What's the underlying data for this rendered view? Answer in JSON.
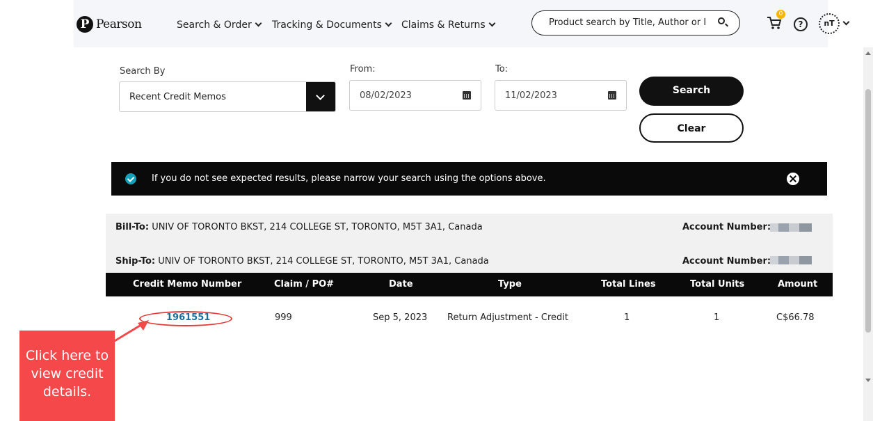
{
  "header": {
    "logo_text": "Pearson",
    "nav": [
      {
        "label": "Search & Order"
      },
      {
        "label": "Tracking & Documents"
      },
      {
        "label": "Claims & Returns"
      }
    ],
    "search_placeholder": "Product search by Title, Author or I",
    "cart_count": "0",
    "help_symbol": "?",
    "avatar_initials": "nT"
  },
  "form": {
    "search_by_label": "Search By",
    "search_by_value": "Recent Credit Memos",
    "from_label": "From:",
    "from_value": "08/02/2023",
    "to_label": "To:",
    "to_value": "11/02/2023",
    "search_button": "Search",
    "clear_button": "Clear"
  },
  "alert": {
    "message": "If you do not see expected results, please narrow your search using the options above."
  },
  "addresses": {
    "bill_to_label": "Bill-To:",
    "bill_to_value": "UNIV OF TORONTO BKST, 214 COLLEGE ST, TORONTO, M5T 3A1, Canada",
    "ship_to_label": "Ship-To:",
    "ship_to_value": "UNIV OF TORONTO BKST, 214 COLLEGE ST, TORONTO, M5T 3A1, Canada",
    "account_label": "Account Number:"
  },
  "table": {
    "headers": [
      "Credit Memo Number",
      "Claim / PO#",
      "Date",
      "Type",
      "Total Lines",
      "Total Units",
      "Amount"
    ],
    "rows": [
      {
        "credit_memo_number": "1961551",
        "claim_po": "999",
        "date": "Sep 5, 2023",
        "type": "Return Adjustment - Credit",
        "total_lines": "1",
        "total_units": "1",
        "amount": "C$66.78"
      }
    ]
  },
  "callout": {
    "text": "Click here to view credit details."
  },
  "colors": {
    "callout": "#f4484a",
    "link": "#1a6fa0",
    "accent_check": "#14a0b8",
    "cart_badge": "#f7b500"
  }
}
